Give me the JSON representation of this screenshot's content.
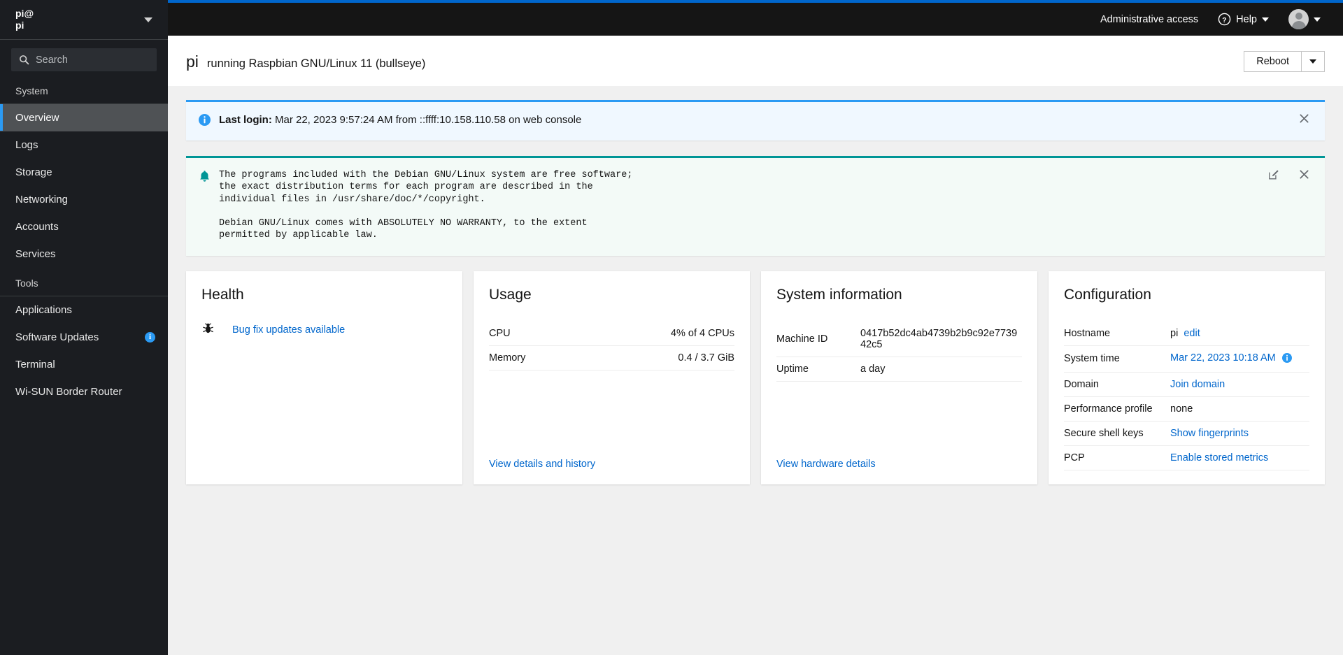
{
  "sidebar": {
    "host": {
      "user": "pi@",
      "name": "pi"
    },
    "search": {
      "placeholder": "Search",
      "value": ""
    },
    "sections": [
      {
        "title": "System",
        "items": [
          {
            "label": "Overview",
            "active": true,
            "badge": ""
          },
          {
            "label": "Logs",
            "active": false,
            "badge": ""
          },
          {
            "label": "Storage",
            "active": false,
            "badge": ""
          },
          {
            "label": "Networking",
            "active": false,
            "badge": ""
          },
          {
            "label": "Accounts",
            "active": false,
            "badge": ""
          },
          {
            "label": "Services",
            "active": false,
            "badge": ""
          }
        ]
      },
      {
        "title": "Tools",
        "items": [
          {
            "label": "Applications",
            "active": false,
            "badge": ""
          },
          {
            "label": "Software Updates",
            "active": false,
            "badge": "i"
          },
          {
            "label": "Terminal",
            "active": false,
            "badge": ""
          },
          {
            "label": "Wi-SUN Border Router",
            "active": false,
            "badge": ""
          }
        ]
      }
    ]
  },
  "topbar": {
    "admin_access": "Administrative access",
    "help": "Help",
    "icons": {
      "help": "question-circle-icon",
      "user": "user-avatar-icon"
    }
  },
  "header": {
    "title": "pi",
    "subtitle": "running Raspbian GNU/Linux 11 (bullseye)",
    "reboot_label": "Reboot"
  },
  "alerts": [
    {
      "type": "info",
      "icon": "info-circle-icon",
      "label": "Last login:",
      "text": " Mar 22, 2023 9:57:24 AM from ::ffff:10.158.110.58 on web console",
      "close_icon": "close-icon"
    },
    {
      "type": "success",
      "icon": "bell-icon",
      "text": "The programs included with the Debian GNU/Linux system are free software;\nthe exact distribution terms for each program are described in the\nindividual files in /usr/share/doc/*/copyright.\n\nDebian GNU/Linux comes with ABSOLUTELY NO WARRANTY, to the extent\npermitted by applicable law.",
      "edit_icon": "edit-icon",
      "close_icon": "close-icon"
    }
  ],
  "cards": {
    "health": {
      "title": "Health",
      "item_icon": "bug-icon",
      "item_label": "Bug fix updates available"
    },
    "usage": {
      "title": "Usage",
      "rows": [
        {
          "label": "CPU",
          "value": "4% of 4 CPUs",
          "percent": 4
        },
        {
          "label": "Memory",
          "value": "0.4 / 3.7 GiB",
          "percent": 11
        }
      ],
      "footer_link": "View details and history"
    },
    "system_information": {
      "title": "System information",
      "rows": [
        {
          "key": "Machine ID",
          "value": "0417b52dc4ab4739b2b9c92e773942c5"
        },
        {
          "key": "Uptime",
          "value": "a day"
        }
      ],
      "footer_link": "View hardware details"
    },
    "configuration": {
      "title": "Configuration",
      "rows": [
        {
          "key": "Hostname",
          "value": "pi",
          "link": "edit",
          "info": false
        },
        {
          "key": "System time",
          "value": "",
          "link": "Mar 22, 2023 10:18 AM",
          "info": true
        },
        {
          "key": "Domain",
          "value": "",
          "link": "Join domain",
          "info": false
        },
        {
          "key": "Performance profile",
          "value": "none",
          "link": "",
          "info": false
        },
        {
          "key": "Secure shell keys",
          "value": "",
          "link": "Show fingerprints",
          "info": false
        },
        {
          "key": "PCP",
          "value": "",
          "link": "Enable stored metrics",
          "info": false
        }
      ]
    }
  },
  "colors": {
    "accent_blue": "#06c",
    "sidebar_bg": "#1b1d21",
    "active_nav": "#4f5255",
    "info_alert": "#2b9af3",
    "success_alert": "#009596"
  }
}
